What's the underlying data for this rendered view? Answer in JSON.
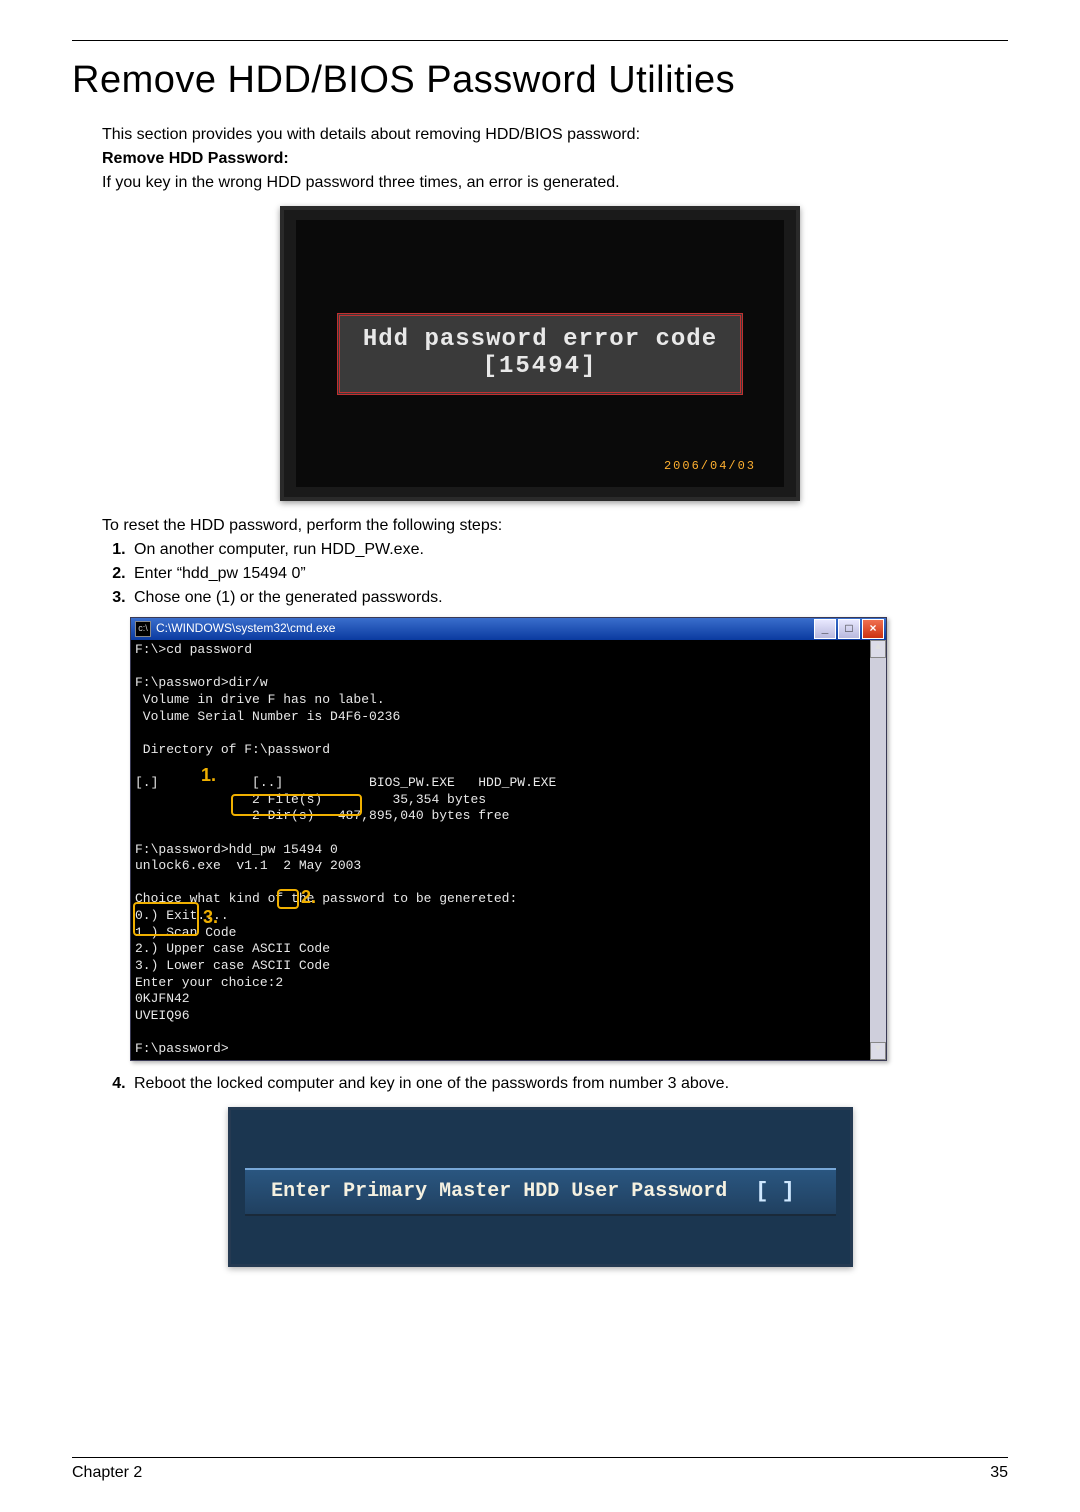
{
  "heading": "Remove HDD/BIOS Password Utilities",
  "intro": "This section provides you with details about removing HDD/BIOS password:",
  "subhead": "Remove HDD Password:",
  "wrong3": "If you key in the wrong HDD password three times, an error is generated.",
  "fig1": {
    "line1": "Hdd password error code",
    "line2": "[15494]",
    "date": "2006/04/03"
  },
  "reset_intro": "To reset the HDD password, perform the following steps:",
  "steps_a": [
    "On another computer, run HDD_PW.exe.",
    "Enter “hdd_pw 15494 0”",
    "Chose one (1) or the generated passwords."
  ],
  "cmd": {
    "title": "C:\\WINDOWS\\system32\\cmd.exe",
    "body": "F:\\>cd password\n\nF:\\password>dir/w\n Volume in drive F has no label.\n Volume Serial Number is D4F6-0236\n\n Directory of F:\\password\n\n[.]            [..]           BIOS_PW.EXE   HDD_PW.EXE\n               2 File(s)         35,354 bytes\n               2 Dir(s)   487,895,040 bytes free\n\nF:\\password>hdd_pw 15494 0\nunlock6.exe  v1.1  2 May 2003\n\nChoice what kind of the password to be genereted:\n0.) Exit....\n1.) Scan Code\n2.) Upper case ASCII Code\n3.) Lower case ASCII Code\nEnter your choice:2\n0KJFN42\nUVEIQ96\n\nF:\\password>",
    "ann1": "1.",
    "ann2": "2.",
    "ann3": "3."
  },
  "step4": "Reboot the locked computer and key in one of the passwords from number 3 above.",
  "fig3": {
    "prompt": "Enter Primary Master HDD User Password",
    "cursor": "[        ]"
  },
  "footer": {
    "left": "Chapter 2",
    "right": "35"
  }
}
